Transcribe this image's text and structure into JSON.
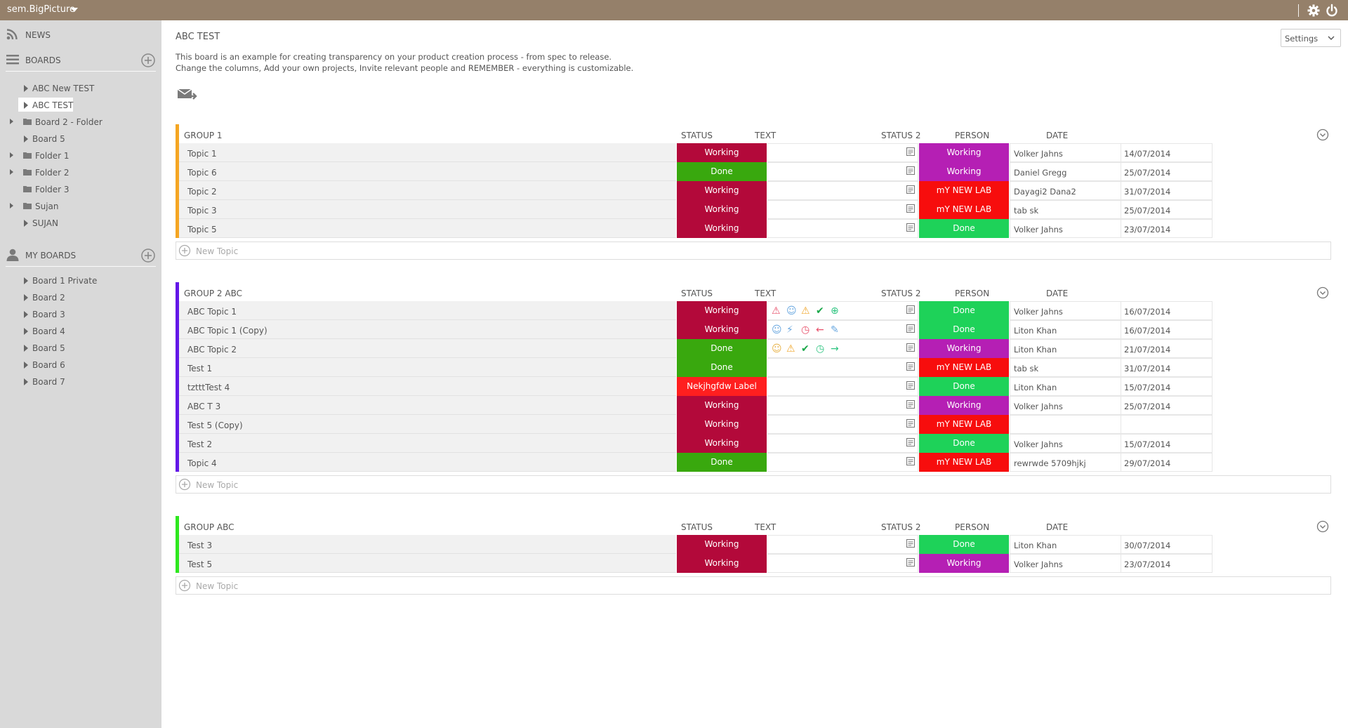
{
  "app": {
    "title": "sem.BigPicture"
  },
  "sidebar": {
    "news_label": "NEWS",
    "boards_label": "BOARDS",
    "myboards_label": "MY BOARDS",
    "boards": [
      {
        "label": "ABC New TEST",
        "type": "board"
      },
      {
        "label": "ABC TEST",
        "type": "board",
        "selected": true
      },
      {
        "label": "Board 2 - Folder",
        "type": "folder",
        "expandable": true
      },
      {
        "label": "Board 5",
        "type": "board"
      },
      {
        "label": "Folder 1",
        "type": "folder",
        "expandable": true
      },
      {
        "label": "Folder 2",
        "type": "folder",
        "expandable": true
      },
      {
        "label": "Folder 3",
        "type": "folder"
      },
      {
        "label": "Sujan",
        "type": "folder",
        "expandable": true
      },
      {
        "label": "SUJAN",
        "type": "board"
      }
    ],
    "my_boards": [
      {
        "label": "Board 1 Private"
      },
      {
        "label": "Board 2"
      },
      {
        "label": "Board 3"
      },
      {
        "label": "Board 4"
      },
      {
        "label": "Board 5"
      },
      {
        "label": "Board 6"
      },
      {
        "label": "Board 7"
      }
    ]
  },
  "page": {
    "title": "ABC TEST",
    "desc_line1": "This board is an example for creating transparency on your product creation process - from spec to release.",
    "desc_line2": "Change the columns, Add your own projects, Invite relevant people and REMEMBER - everything is customizable.",
    "settings_label": "Settings"
  },
  "columns": {
    "status": "STATUS",
    "text": "TEXT",
    "status2": "STATUS 2",
    "person": "PERSON",
    "date": "DATE"
  },
  "new_topic_label": "New Topic",
  "status_colors": {
    "Working": "#b3093a",
    "Done": "#39a80e",
    "Nekjhgfdw Label": "#ff1f1f",
    "status2_Working": "#b51fb4",
    "status2_Done": "#1ed259",
    "mY NEW LAB": "#f70d0d"
  },
  "groups": [
    {
      "name": "GROUP 1",
      "color": "#f5a623",
      "rows": [
        {
          "topic": "Topic 1",
          "status": "Working",
          "status2": "Working",
          "person": "Volker Jahns",
          "date": "14/07/2014",
          "icons": []
        },
        {
          "topic": "Topic 6",
          "status": "Done",
          "status2": "Working",
          "person": "Daniel Gregg",
          "date": "25/07/2014",
          "icons": []
        },
        {
          "topic": "Topic 2",
          "status": "Working",
          "status2": "mY NEW LAB",
          "person": "Dayagi2 Dana2",
          "date": "31/07/2014",
          "icons": []
        },
        {
          "topic": "Topic 3",
          "status": "Working",
          "status2": "mY NEW LAB",
          "person": "tab sk",
          "date": "25/07/2014",
          "icons": []
        },
        {
          "topic": "Topic 5",
          "status": "Working",
          "status2": "Done",
          "person": "Volker Jahns",
          "date": "23/07/2014",
          "icons": []
        }
      ]
    },
    {
      "name": "GROUP 2 ABC",
      "color": "#6317e8",
      "rows": [
        {
          "topic": "ABC Topic 1",
          "status": "Working",
          "status2": "Done",
          "person": "Volker Jahns",
          "date": "16/07/2014",
          "icons": [
            "warning-red-icon",
            "smile-icon",
            "warning-yellow-icon",
            "check-icon",
            "plus-circle-icon"
          ]
        },
        {
          "topic": "ABC Topic 1 (Copy)",
          "status": "Working",
          "status2": "Done",
          "person": "Liton Khan",
          "date": "16/07/2014",
          "icons": [
            "smile-icon",
            "lightning-icon",
            "clock-icon",
            "arrow-left-icon",
            "pencil-icon"
          ]
        },
        {
          "topic": "ABC Topic 2",
          "status": "Done",
          "status2": "Working",
          "person": "Liton Khan",
          "date": "21/07/2014",
          "icons": [
            "smile-yellow-icon",
            "warning-yellow-icon",
            "check-icon",
            "clock-green-icon",
            "arrow-right-icon"
          ]
        },
        {
          "topic": "Test 1",
          "status": "Done",
          "status2": "mY NEW LAB",
          "person": "tab sk",
          "date": "31/07/2014",
          "icons": []
        },
        {
          "topic": "tztttTest 4",
          "status": "Nekjhgfdw Label",
          "status2": "Done",
          "person": "Liton Khan",
          "date": "15/07/2014",
          "icons": []
        },
        {
          "topic": "ABC T 3",
          "status": "Working",
          "status2": "Working",
          "person": "Volker Jahns",
          "date": "25/07/2014",
          "icons": []
        },
        {
          "topic": "Test 5 (Copy)",
          "status": "Working",
          "status2": "mY NEW LAB",
          "person": "",
          "date": "",
          "icons": []
        },
        {
          "topic": "Test 2",
          "status": "Working",
          "status2": "Done",
          "person": "Volker Jahns",
          "date": "15/07/2014",
          "icons": []
        },
        {
          "topic": "Topic 4",
          "status": "Done",
          "status2": "mY NEW LAB",
          "person": "rewrwde 5709hjkj",
          "date": "29/07/2014",
          "icons": []
        }
      ]
    },
    {
      "name": "GROUP ABC",
      "color": "#2ee81f",
      "rows": [
        {
          "topic": "Test 3",
          "status": "Working",
          "status2": "Done",
          "person": "Liton Khan",
          "date": "30/07/2014",
          "icons": []
        },
        {
          "topic": "Test 5",
          "status": "Working",
          "status2": "Working",
          "person": "Volker Jahns",
          "date": "23/07/2014",
          "icons": []
        }
      ]
    }
  ]
}
